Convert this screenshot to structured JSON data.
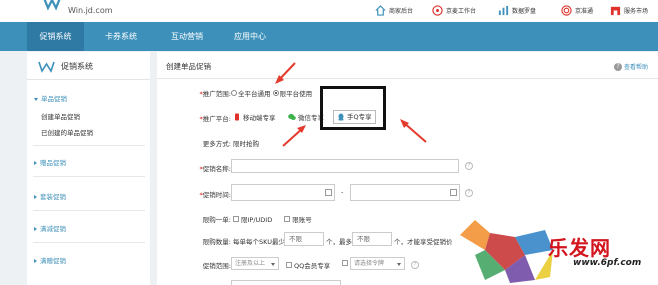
{
  "header": {
    "logo_url": "Win.jd.com",
    "top_links": [
      {
        "label": "商家后台",
        "sub": "后台",
        "icon": "house-icon"
      },
      {
        "label": "京麦工作台",
        "sub": "工作台",
        "icon": "compass-icon"
      },
      {
        "label": "数据罗盘",
        "sub": "罗盘",
        "icon": "chart-icon"
      },
      {
        "label": "京准通",
        "sub": "",
        "icon": "target-icon"
      },
      {
        "label": "服务市场",
        "sub": "",
        "icon": "store-icon"
      }
    ]
  },
  "nav": {
    "items": [
      {
        "label": "促销系统"
      },
      {
        "label": "卡券系统"
      },
      {
        "label": "互动营销"
      },
      {
        "label": "应用中心"
      }
    ]
  },
  "sidebar": {
    "title": "促销系统",
    "groups": [
      {
        "label": "单品促销",
        "expanded": true,
        "children": [
          "创建单品促销",
          "已创建的单品促销"
        ]
      },
      {
        "label": "赠品促销",
        "expanded": false
      },
      {
        "label": "套装促销",
        "expanded": false
      },
      {
        "label": "满减促销",
        "expanded": false
      },
      {
        "label": "满赠促销",
        "expanded": false
      }
    ]
  },
  "main": {
    "title": "创建单品促销",
    "help": "查看帮助",
    "scope": {
      "label": "推广范围:",
      "req": "*",
      "options": [
        "全平台通用",
        "限平台使用"
      ],
      "selected": 1
    },
    "platform": {
      "label": "推广平台:",
      "options": [
        "移动端专享",
        "微信专享",
        "手Q专享"
      ]
    },
    "more": {
      "label": "更多方式:",
      "value": "限时抢购"
    },
    "name": {
      "label": "促销名称:",
      "req": "*"
    },
    "time": {
      "label": "促销时间:",
      "req": "*",
      "sep": "-"
    },
    "limit_one": {
      "label": "限购一单:",
      "opts": [
        "限IP/UDID",
        "限账号"
      ]
    },
    "limit_qty": {
      "label": "限购数量:",
      "pre": "每单每个SKU最少",
      "min": "不限",
      "mid": "个，最多",
      "max": "不限",
      "post": "个，才能享受促销价"
    },
    "range": {
      "label": "促销范围:",
      "select1": "注册及以上",
      "qq": "QQ会员专享",
      "select2": "请选择令牌"
    }
  },
  "watermark": {
    "text": "乐发网",
    "url": "www.6pf.com"
  },
  "colors": {
    "nav": "#3c90ba",
    "nav_active": "#2e7aa4",
    "arrow": "#e53b2f",
    "brand_red": "#d3151d"
  }
}
